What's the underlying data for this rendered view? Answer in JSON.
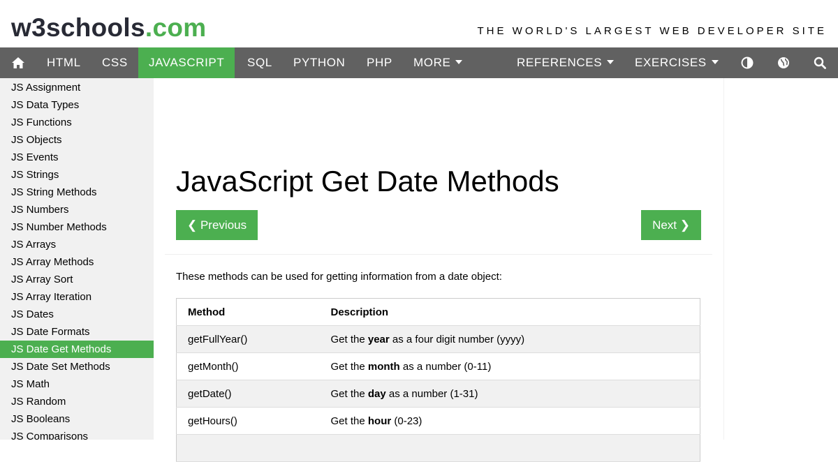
{
  "header": {
    "logo_main": "w3schools",
    "logo_suffix": ".com",
    "tagline": "THE WORLD'S LARGEST WEB DEVELOPER SITE"
  },
  "topnav": {
    "home_icon": "home-icon",
    "items": [
      "HTML",
      "CSS",
      "JAVASCRIPT",
      "SQL",
      "PYTHON",
      "PHP",
      "MORE"
    ],
    "active": "JAVASCRIPT",
    "references": "REFERENCES",
    "exercises": "EXERCISES",
    "icons": [
      "contrast-icon",
      "globe-icon",
      "search-icon"
    ],
    "colors": {
      "bar": "#616161",
      "active": "#4CAF50"
    }
  },
  "sidebar": {
    "items": [
      "JS Assignment",
      "JS Data Types",
      "JS Functions",
      "JS Objects",
      "JS Events",
      "JS Strings",
      "JS String Methods",
      "JS Numbers",
      "JS Number Methods",
      "JS Arrays",
      "JS Array Methods",
      "JS Array Sort",
      "JS Array Iteration",
      "JS Dates",
      "JS Date Formats",
      "JS Date Get Methods",
      "JS Date Set Methods",
      "JS Math",
      "JS Random",
      "JS Booleans",
      "JS Comparisons"
    ],
    "active": "JS Date Get Methods"
  },
  "main": {
    "title": "JavaScript Get Date Methods",
    "prev_label": "❮ Previous",
    "next_label": "Next ❯",
    "intro": "These methods can be used for getting information from a date object:",
    "table": {
      "headers": [
        "Method",
        "Description"
      ],
      "rows": [
        {
          "method": "getFullYear()",
          "pre": "Get the ",
          "bold": "year",
          "post": " as a four digit number (yyyy)"
        },
        {
          "method": "getMonth()",
          "pre": "Get the ",
          "bold": "month",
          "post": " as a number (0-11)"
        },
        {
          "method": "getDate()",
          "pre": "Get the ",
          "bold": "day",
          "post": " as a number (1-31)"
        },
        {
          "method": "getHours()",
          "pre": "Get the ",
          "bold": "hour",
          "post": " (0-23)"
        }
      ]
    }
  }
}
